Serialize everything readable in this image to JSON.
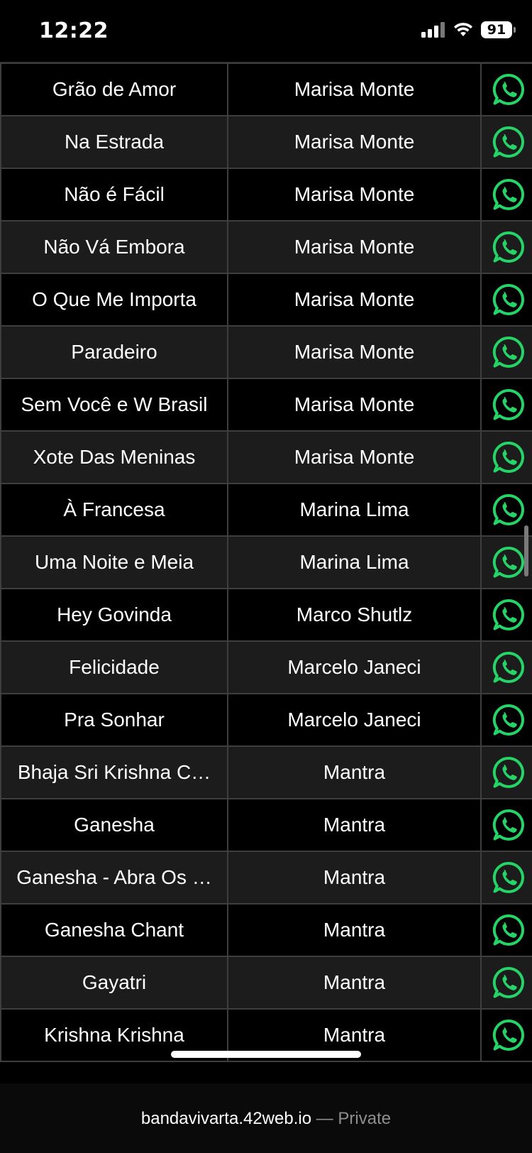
{
  "status_bar": {
    "time": "12:22",
    "battery": "91"
  },
  "rows": [
    {
      "song": "Grão de Amor",
      "artist": "Marisa Monte"
    },
    {
      "song": "Na Estrada",
      "artist": "Marisa Monte"
    },
    {
      "song": "Não é Fácil",
      "artist": "Marisa Monte"
    },
    {
      "song": "Não Vá Embora",
      "artist": "Marisa Monte"
    },
    {
      "song": "O Que Me Importa",
      "artist": "Marisa Monte"
    },
    {
      "song": "Paradeiro",
      "artist": "Marisa Monte"
    },
    {
      "song": "Sem Você e W Brasil",
      "artist": "Marisa Monte"
    },
    {
      "song": "Xote Das Meninas",
      "artist": "Marisa Monte"
    },
    {
      "song": "À Francesa",
      "artist": "Marina Lima"
    },
    {
      "song": "Uma Noite e Meia",
      "artist": "Marina Lima"
    },
    {
      "song": "Hey Govinda",
      "artist": "Marco Shutlz"
    },
    {
      "song": "Felicidade",
      "artist": "Marcelo Janeci"
    },
    {
      "song": "Pra Sonhar",
      "artist": "Marcelo Janeci"
    },
    {
      "song": "Bhaja Sri Krishna C…",
      "artist": "Mantra"
    },
    {
      "song": "Ganesha",
      "artist": "Mantra"
    },
    {
      "song": "Ganesha - Abra Os …",
      "artist": "Mantra"
    },
    {
      "song": "Ganesha Chant",
      "artist": "Mantra"
    },
    {
      "song": "Gayatri",
      "artist": "Mantra"
    },
    {
      "song": "Krishna Krishna",
      "artist": "Mantra"
    }
  ],
  "share_icon": "whatsapp-icon",
  "browser": {
    "host": "bandavivarta.42web.io",
    "separator": "— Private"
  },
  "colors": {
    "whatsapp_green": "#25D366",
    "background": "#000000",
    "row_alt": "#1c1c1c"
  }
}
